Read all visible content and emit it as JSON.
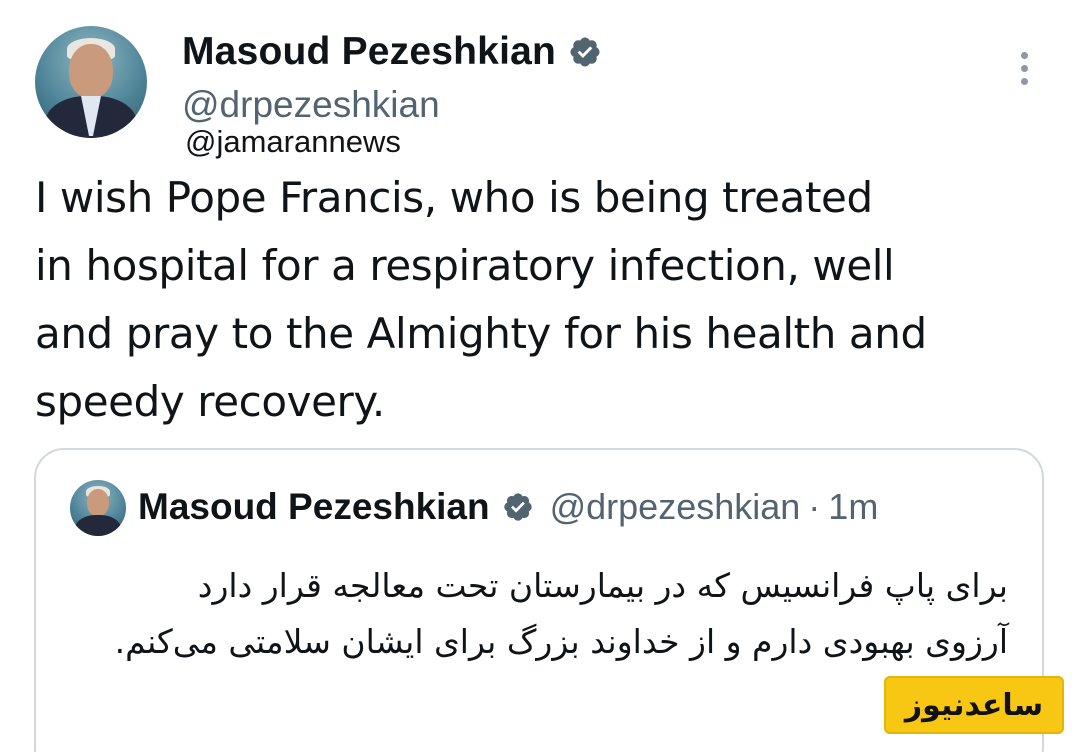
{
  "tweet": {
    "author": {
      "display_name": "Masoud Pezeshkian",
      "handle": "@drpezeshkian",
      "verified": true
    },
    "overlay_handle": "@jamarannews",
    "text": "I wish Pope Francis, who is being treated\nin hospital for a respiratory infection, well\nand pray to the Almighty for his health and\nspeedy recovery.",
    "more_icon": "more-vertical-icon"
  },
  "quoted_tweet": {
    "author": {
      "display_name": "Masoud Pezeshkian",
      "handle": "@drpezeshkian",
      "verified": true
    },
    "separator": "·",
    "time": "1m",
    "text": "برای پاپ فرانسیس که در بیمارستان تحت معالجه قرار دارد آرزوی بهبودی دارم و از خداوند بزرگ برای ایشان سلامتی می‌کنم."
  },
  "watermark": {
    "logo_text": "ساعدنیوز"
  },
  "colors": {
    "text_primary": "#0f1419",
    "text_secondary": "#536471",
    "verified_badge": "#536471",
    "border": "#cfd9de",
    "logo_background": "#f7c713"
  }
}
